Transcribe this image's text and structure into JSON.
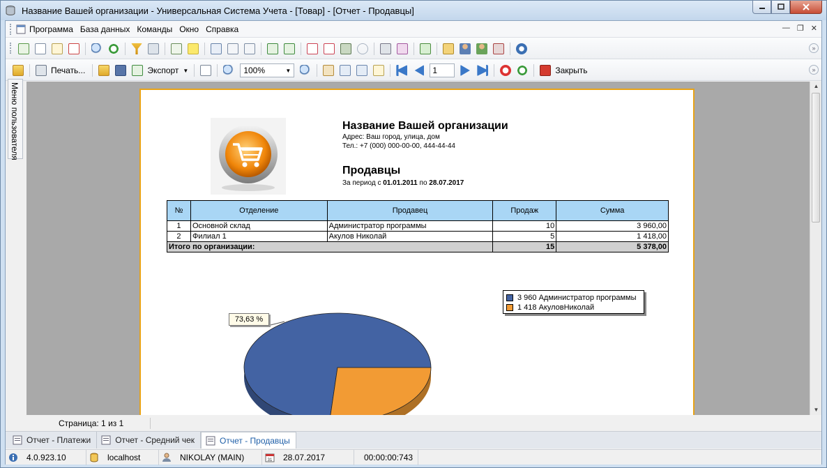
{
  "window": {
    "title": "Название Вашей организации - Универсальная Система Учета - [Товар] - [Отчет - Продавцы]"
  },
  "menu": {
    "items": [
      "Программа",
      "База данных",
      "Команды",
      "Окно",
      "Справка"
    ]
  },
  "toolbar2": {
    "print_label": "Печать...",
    "export_label": "Экспорт",
    "zoom_value": "100%",
    "page_value": "1",
    "close_label": "Закрыть"
  },
  "sidebar": {
    "tab_label": "Меню пользователя"
  },
  "report": {
    "org_name": "Название Вашей организации",
    "address": "Адрес: Ваш город, улица, дом",
    "phone": "Тел.: +7 (000) 000-00-00, 444-44-44",
    "title": "Продавцы",
    "period_prefix": "За период с",
    "period_from": "01.01.2011",
    "period_mid": "по",
    "period_to": "28.07.2017",
    "table": {
      "headers": [
        "№",
        "Отделение",
        "Продавец",
        "Продаж",
        "Сумма"
      ],
      "rows": [
        {
          "num": "1",
          "dept": "Основной склад",
          "seller": "Администратор программы",
          "count": "10",
          "sum": "3 960,00"
        },
        {
          "num": "2",
          "dept": "Филиал 1",
          "seller": "Акулов Николай",
          "count": "5",
          "sum": "1 418,00"
        }
      ],
      "total": {
        "label": "Итого по организации:",
        "count": "15",
        "sum": "5 378,00"
      }
    },
    "chart_data": {
      "type": "pie",
      "categories": [
        "Администратор программы",
        "АкуловНиколай"
      ],
      "values": [
        3960,
        1418
      ],
      "legend": [
        "3 960 Администратор программы",
        "1 418 АкуловНиколай"
      ],
      "colors": [
        "#4363a3",
        "#f29b34"
      ],
      "data_label": "73,63 %",
      "legend_position": "top-right"
    }
  },
  "status": {
    "page_text": "Страница: 1 из 1"
  },
  "tabs": [
    {
      "label": "Отчет - Платежи",
      "active": false
    },
    {
      "label": "Отчет - Средний чек",
      "active": false
    },
    {
      "label": "Отчет - Продавцы",
      "active": true
    }
  ],
  "info": {
    "version": "4.0.923.10",
    "server": "localhost",
    "user": "NIKOLAY (MAIN)",
    "date": "28.07.2017",
    "timer": "00:00:00:743"
  }
}
